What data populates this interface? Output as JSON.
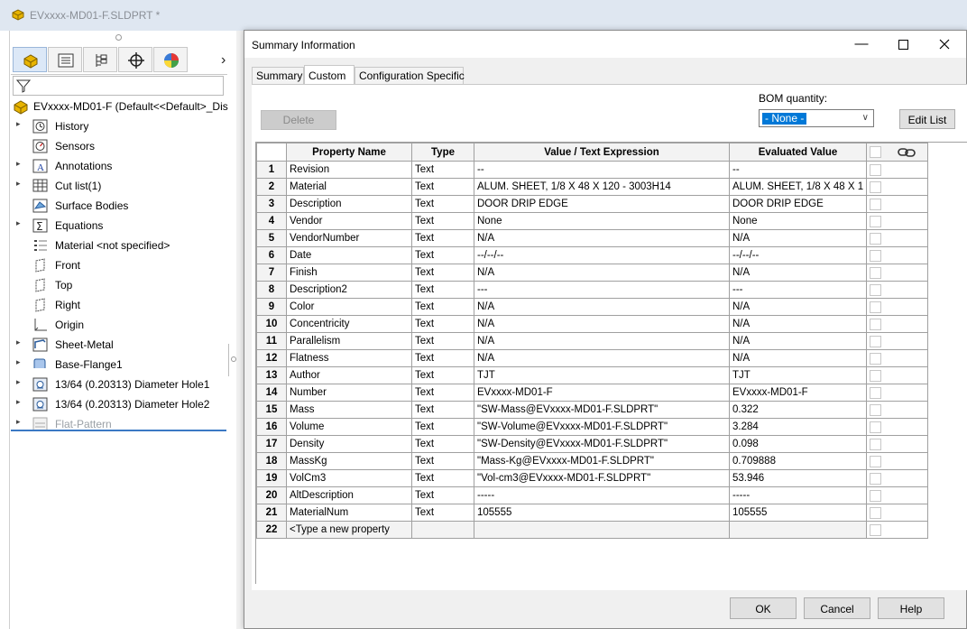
{
  "window": {
    "title": "EVxxxx-MD01-F.SLDPRT *"
  },
  "tree": {
    "root_label": "EVxxxx-MD01-F  (Default<<Default>_Dis",
    "items": [
      {
        "label": "History",
        "icon": "history-icon",
        "expandable": true
      },
      {
        "label": "Sensors",
        "icon": "sensor-icon",
        "expandable": false
      },
      {
        "label": "Annotations",
        "icon": "annotation-icon",
        "expandable": true
      },
      {
        "label": "Cut list(1)",
        "icon": "cut-list-icon",
        "expandable": true
      },
      {
        "label": "Surface Bodies",
        "icon": "surface-bodies-icon",
        "expandable": false
      },
      {
        "label": "Equations",
        "icon": "equations-icon",
        "expandable": true
      },
      {
        "label": "Material <not specified>",
        "icon": "material-icon",
        "expandable": false
      },
      {
        "label": "Front",
        "icon": "plane-icon",
        "expandable": false
      },
      {
        "label": "Top",
        "icon": "plane-icon",
        "expandable": false
      },
      {
        "label": "Right",
        "icon": "plane-icon",
        "expandable": false
      },
      {
        "label": "Origin",
        "icon": "origin-icon",
        "expandable": false
      },
      {
        "label": "Sheet-Metal",
        "icon": "sheet-metal-icon",
        "expandable": true
      },
      {
        "label": "Base-Flange1",
        "icon": "base-flange-icon",
        "expandable": true
      },
      {
        "label": "13/64 (0.20313) Diameter Hole1",
        "icon": "hole-icon",
        "expandable": true
      },
      {
        "label": "13/64 (0.20313) Diameter Hole2",
        "icon": "hole-icon",
        "expandable": true
      },
      {
        "label": "Flat-Pattern",
        "icon": "flat-pattern-icon",
        "expandable": true,
        "dimmed": true
      }
    ]
  },
  "dialog": {
    "title": "Summary Information",
    "tabs": [
      "Summary",
      "Custom",
      "Configuration Specific"
    ],
    "active_tab": "Custom",
    "delete_label": "Delete",
    "bom_label": "BOM quantity:",
    "bom_value": "- None -",
    "edit_list_label": "Edit List",
    "columns": [
      "Property Name",
      "Type",
      "Value / Text Expression",
      "Evaluated Value"
    ],
    "rows": [
      {
        "num": "1",
        "name": "Revision",
        "type": "Text",
        "value": "--",
        "evaluated": "--"
      },
      {
        "num": "2",
        "name": "Material",
        "type": "Text",
        "value": "ALUM. SHEET, 1/8 X 48 X 120 - 3003H14",
        "evaluated": "ALUM. SHEET, 1/8 X 48 X 1"
      },
      {
        "num": "3",
        "name": "Description",
        "type": "Text",
        "value": "DOOR DRIP EDGE",
        "evaluated": "DOOR DRIP EDGE"
      },
      {
        "num": "4",
        "name": "Vendor",
        "type": "Text",
        "value": "None",
        "evaluated": "None"
      },
      {
        "num": "5",
        "name": "VendorNumber",
        "type": "Text",
        "value": "N/A",
        "evaluated": "N/A"
      },
      {
        "num": "6",
        "name": "Date",
        "type": "Text",
        "value": "--/--/--",
        "evaluated": "--/--/--"
      },
      {
        "num": "7",
        "name": "Finish",
        "type": "Text",
        "value": "N/A",
        "evaluated": "N/A"
      },
      {
        "num": "8",
        "name": "Description2",
        "type": "Text",
        "value": "---",
        "evaluated": "---"
      },
      {
        "num": "9",
        "name": "Color",
        "type": "Text",
        "value": "N/A",
        "evaluated": "N/A"
      },
      {
        "num": "10",
        "name": "Concentricity",
        "type": "Text",
        "value": "N/A",
        "evaluated": "N/A"
      },
      {
        "num": "11",
        "name": "Parallelism",
        "type": "Text",
        "value": "N/A",
        "evaluated": "N/A"
      },
      {
        "num": "12",
        "name": "Flatness",
        "type": "Text",
        "value": "N/A",
        "evaluated": "N/A"
      },
      {
        "num": "13",
        "name": "Author",
        "type": "Text",
        "value": "TJT",
        "evaluated": "TJT"
      },
      {
        "num": "14",
        "name": "Number",
        "type": "Text",
        "value": "EVxxxx-MD01-F",
        "evaluated": "EVxxxx-MD01-F"
      },
      {
        "num": "15",
        "name": "Mass",
        "type": "Text",
        "value": "\"SW-Mass@EVxxxx-MD01-F.SLDPRT\"",
        "evaluated": "0.322"
      },
      {
        "num": "16",
        "name": "Volume",
        "type": "Text",
        "value": "\"SW-Volume@EVxxxx-MD01-F.SLDPRT\"",
        "evaluated": "3.284"
      },
      {
        "num": "17",
        "name": "Density",
        "type": "Text",
        "value": "\"SW-Density@EVxxxx-MD01-F.SLDPRT\"",
        "evaluated": "0.098"
      },
      {
        "num": "18",
        "name": "MassKg",
        "type": "Text",
        "value": "\"Mass-Kg@EVxxxx-MD01-F.SLDPRT\"",
        "evaluated": "0.709888"
      },
      {
        "num": "19",
        "name": "VolCm3",
        "type": "Text",
        "value": "\"Vol-cm3@EVxxxx-MD01-F.SLDPRT\"",
        "evaluated": "53.946"
      },
      {
        "num": "20",
        "name": "AltDescription",
        "type": "Text",
        "value": "-----",
        "evaluated": "-----"
      },
      {
        "num": "21",
        "name": "MaterialNum",
        "type": "Text",
        "value": "105555",
        "evaluated": "105555"
      }
    ],
    "new_row": {
      "num": "22",
      "placeholder": "<Type a new property"
    },
    "buttons": {
      "ok": "OK",
      "cancel": "Cancel",
      "help": "Help"
    }
  }
}
